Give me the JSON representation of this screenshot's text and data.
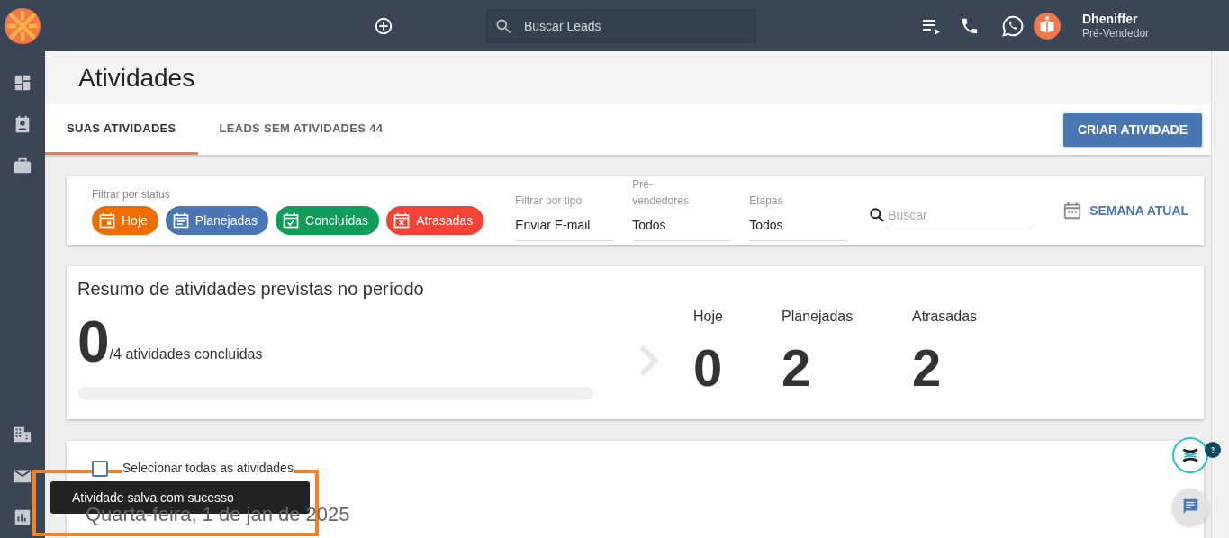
{
  "header": {
    "search": {
      "placeholder": "Buscar Leads"
    },
    "user": {
      "name": "Dheniffer",
      "role": "Pré-Vendedor"
    }
  },
  "page": {
    "title": "Atividades"
  },
  "tabs": [
    {
      "label": "SUAS ATIVIDADES",
      "selected": true
    },
    {
      "label": "LEADS SEM ATIVIDADES 44",
      "selected": false
    }
  ],
  "create_button": "CRIAR ATIVIDADE",
  "filters": {
    "status_label": "Filtrar por status",
    "status_chips": [
      {
        "label": "Hoje",
        "kind": "today",
        "color": "#ef6c00"
      },
      {
        "label": "Planejadas",
        "kind": "planned",
        "color": "#4a76b4"
      },
      {
        "label": "Concluídas",
        "kind": "done",
        "color": "#0f9d58"
      },
      {
        "label": "Atrasadas",
        "kind": "late",
        "color": "#f44336"
      }
    ],
    "selects": [
      {
        "label": "Filtrar por tipo",
        "value": "Enviar E-mail"
      },
      {
        "label": "Pré-vendedores",
        "value": "Todos"
      },
      {
        "label": "Etapas",
        "value": "Todos"
      }
    ],
    "search": {
      "placeholder": "Buscar"
    },
    "period_button": "SEMANA ATUAL"
  },
  "summary": {
    "title": "Resumo de atividades previstas no período",
    "done": "0",
    "total_text": "/4 atividades concluidas",
    "level": 0,
    "stats": [
      {
        "label": "Hoje",
        "value": "0"
      },
      {
        "label": "Planejadas",
        "value": "2"
      },
      {
        "label": "Atrasadas",
        "value": "2"
      }
    ]
  },
  "list": {
    "select_all": {
      "label": "Selecionar todas as atividades",
      "checked": false
    },
    "date_heading": "Quarta-feira, 1 de jan de 2025"
  },
  "toast": {
    "message": "Atividade salva com sucesso"
  }
}
